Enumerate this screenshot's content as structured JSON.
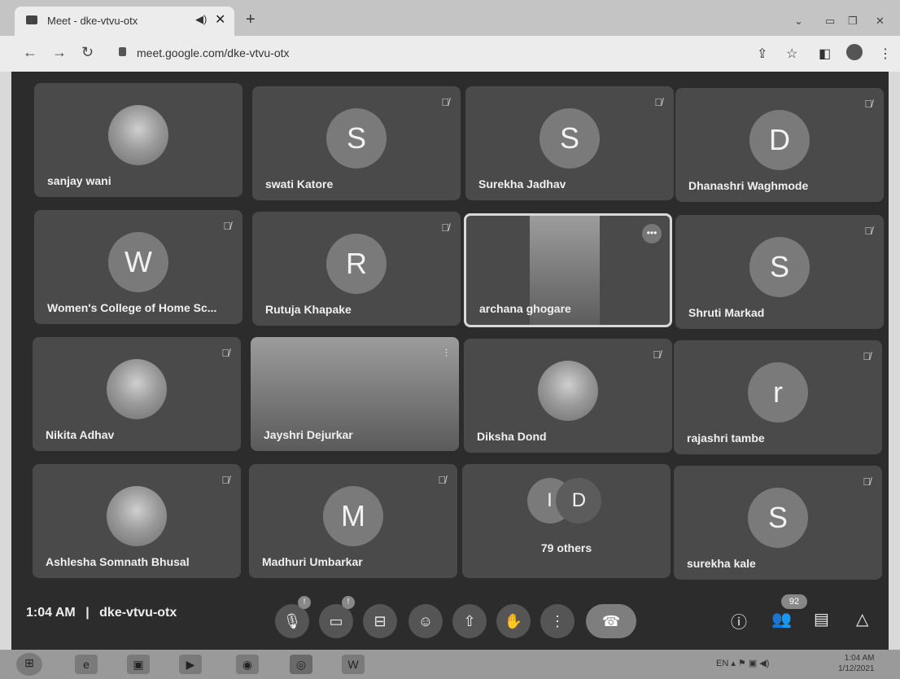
{
  "browser": {
    "tab_title": "Meet - dke-vtvu-otx",
    "url": "meet.google.com/dke-vtvu-otx"
  },
  "participants": [
    {
      "name": "sanjay wani",
      "initial": "",
      "muted": false,
      "photo": true
    },
    {
      "name": "swati Katore",
      "initial": "S",
      "muted": true,
      "photo": false
    },
    {
      "name": "Surekha Jadhav",
      "initial": "S",
      "muted": true,
      "photo": false
    },
    {
      "name": "Dhanashri Waghmode",
      "initial": "D",
      "muted": true,
      "photo": false
    },
    {
      "name": "Women's College of Home Sc...",
      "initial": "W",
      "muted": true,
      "photo": false
    },
    {
      "name": "Rutuja Khapake",
      "initial": "R",
      "muted": true,
      "photo": false
    },
    {
      "name": "archana ghogare",
      "initial": "",
      "muted": false,
      "photo": true
    },
    {
      "name": "Shruti Markad",
      "initial": "S",
      "muted": true,
      "photo": false
    },
    {
      "name": "Nikita Adhav",
      "initial": "",
      "muted": true,
      "photo": true
    },
    {
      "name": "Jayshri Dejurkar",
      "initial": "",
      "muted": false,
      "photo": true
    },
    {
      "name": "Diksha Dond",
      "initial": "",
      "muted": true,
      "photo": true
    },
    {
      "name": "rajashri tambe",
      "initial": "r",
      "muted": true,
      "photo": false
    },
    {
      "name": "Ashlesha Somnath Bhusal",
      "initial": "",
      "muted": true,
      "photo": true
    },
    {
      "name": "Madhuri Umbarkar",
      "initial": "M",
      "muted": true,
      "photo": false
    },
    {
      "name": "79 others",
      "initial": "",
      "muted": false,
      "photo": false,
      "group_initials": [
        "I",
        "D"
      ]
    },
    {
      "name": "surekha kale",
      "initial": "S",
      "muted": true,
      "photo": false
    }
  ],
  "meeting": {
    "time": "1:04 AM",
    "separator": "|",
    "code": "dke-vtvu-otx",
    "participant_count": "92"
  },
  "taskbar": {
    "lang": "EN",
    "time": "1:04 AM",
    "date": "1/12/2021"
  }
}
